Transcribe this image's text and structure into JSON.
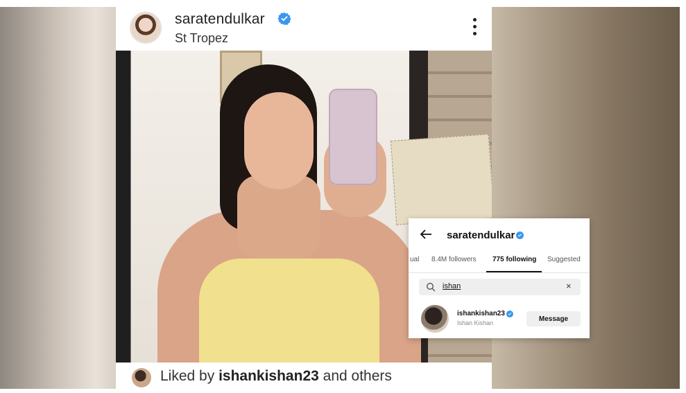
{
  "post": {
    "username": "saratendulkar",
    "location": "St Tropez",
    "liked_prefix": "Liked by",
    "liked_user": "ishankishan23",
    "liked_suffix": "and others"
  },
  "overlay": {
    "username": "saratendulkar",
    "tabs": [
      {
        "label": "ual"
      },
      {
        "label": "8.4M followers"
      },
      {
        "label": "775 following",
        "active": true
      },
      {
        "label": "Suggested"
      }
    ],
    "search_value": "ishan",
    "result": {
      "username": "ishankishan23",
      "name": "Ishan Kishan",
      "button_label": "Message"
    }
  },
  "colors": {
    "verified_blue": "#3897f0",
    "button_bg": "#efefef"
  },
  "icons": [
    "verified-badge-icon",
    "kebab-menu-icon",
    "back-arrow-icon",
    "search-icon",
    "clear-icon"
  ]
}
